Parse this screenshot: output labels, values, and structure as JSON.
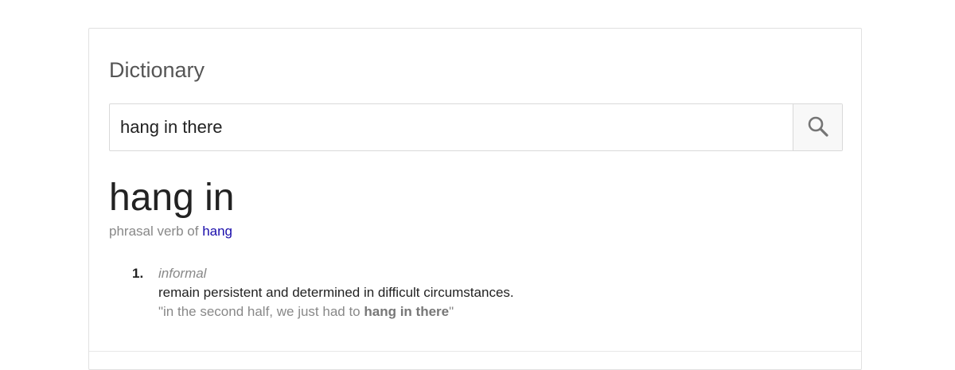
{
  "card": {
    "title": "Dictionary"
  },
  "search": {
    "value": "hang in there",
    "button_icon": "search-icon"
  },
  "entry": {
    "headword": "hang in",
    "part_of_speech_prefix": "phrasal verb of ",
    "part_of_speech_link": "hang",
    "senses": [
      {
        "number": "1.",
        "label": "informal",
        "definition": "remain persistent and determined in difficult circumstances.",
        "example_before": "\"in the second half, we just had to ",
        "example_bold": "hang in there",
        "example_after": "\""
      }
    ]
  },
  "colors": {
    "link": "#1a0dab",
    "muted": "#888888",
    "text": "#222222"
  }
}
